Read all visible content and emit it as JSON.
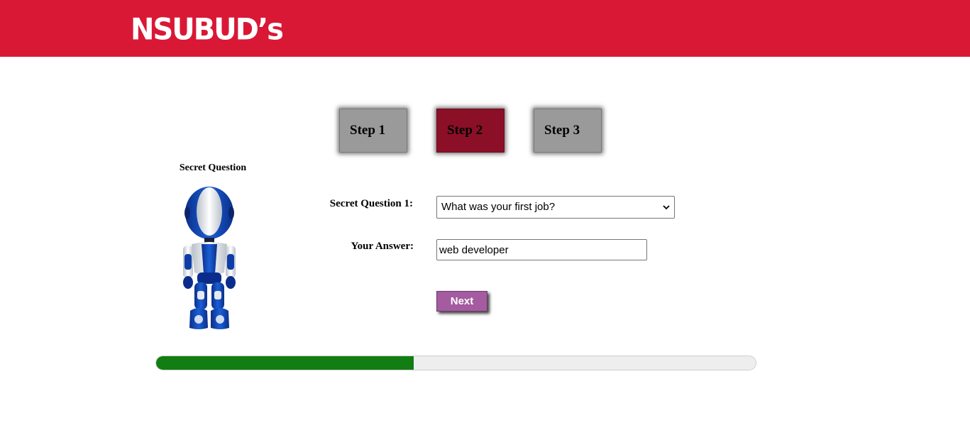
{
  "header": {
    "logo_text": "NSUBUD’s",
    "background_color": "#d91835"
  },
  "steps": [
    {
      "label": "Step 1",
      "state": "inactive"
    },
    {
      "label": "Step 2",
      "state": "active"
    },
    {
      "label": "Step 3",
      "state": "inactive"
    }
  ],
  "sidebar": {
    "title": "Secret Question",
    "image": "robot-illustration"
  },
  "form": {
    "question_label": "Secret Question 1:",
    "question_selected": "What was your first job?",
    "answer_label": "Your Answer:",
    "answer_value": "web developer",
    "next_label": "Next"
  },
  "progress": {
    "fraction": 0.43,
    "fill_color": "#127d12",
    "track_color": "#eeeeee"
  },
  "colors": {
    "step_active": "#8b1027",
    "step_inactive": "#9a9a9a",
    "next_button": "#a45ba0"
  }
}
